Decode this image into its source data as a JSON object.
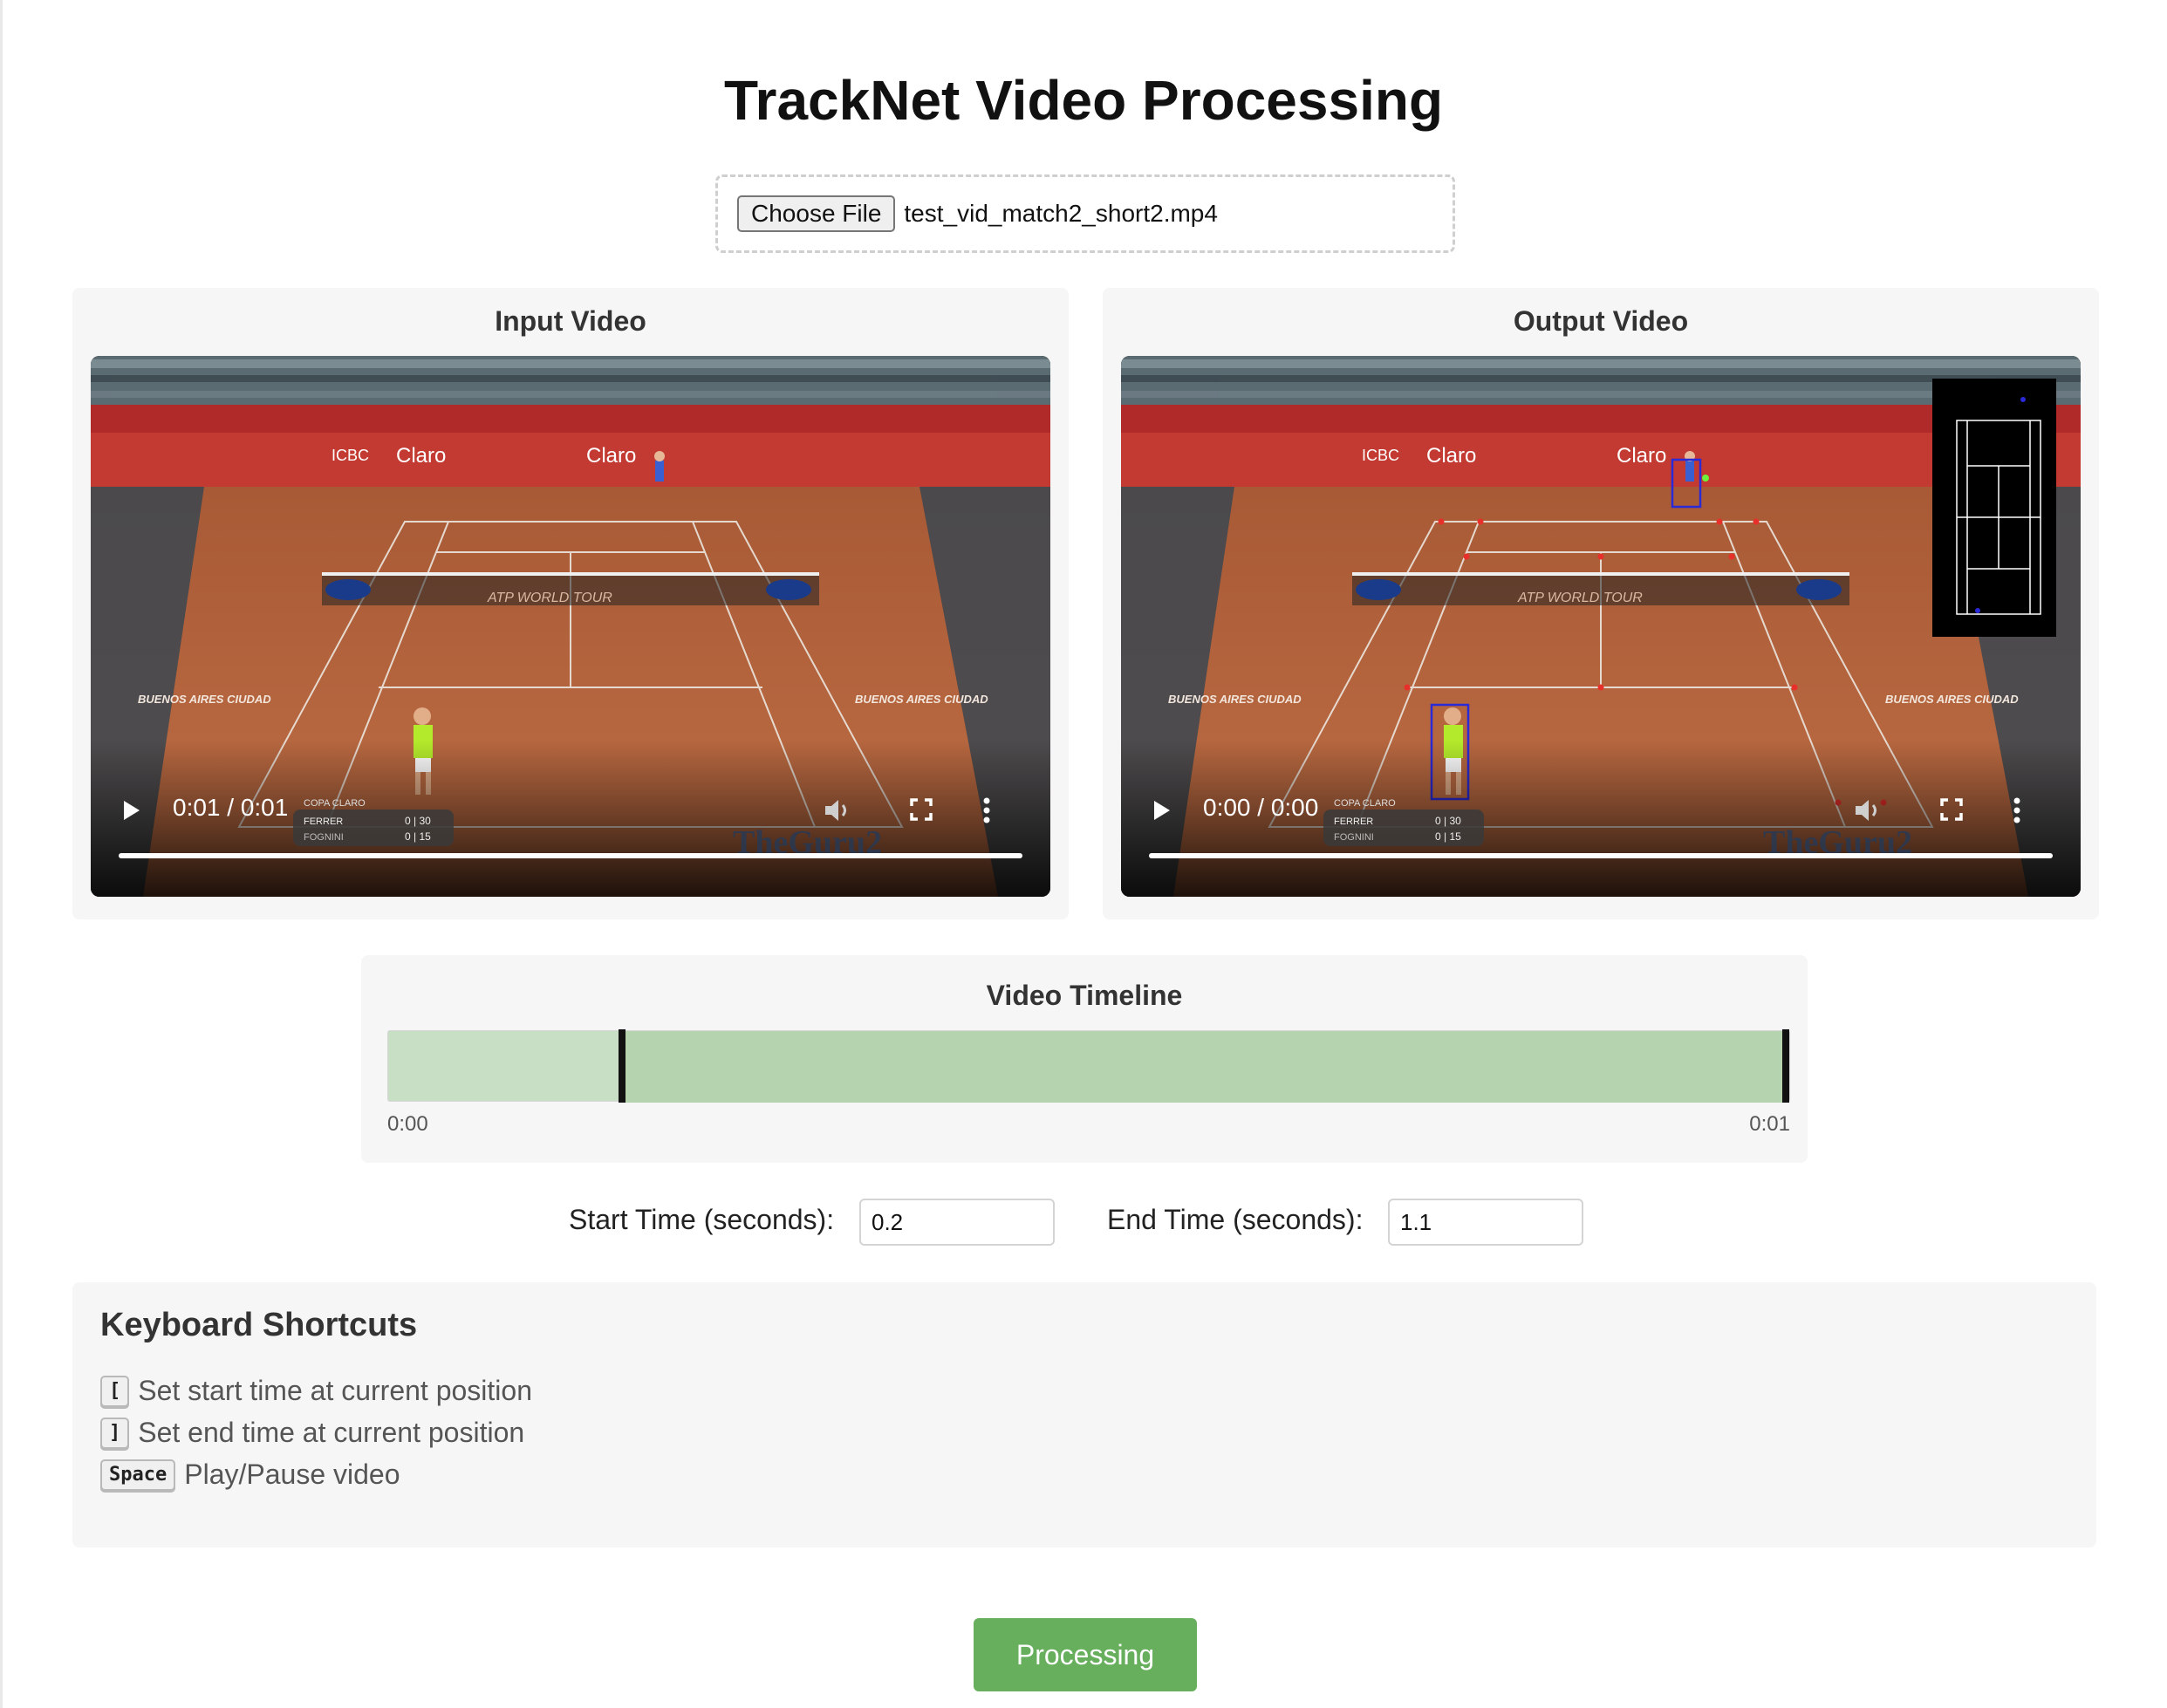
{
  "title": "TrackNet Video Processing",
  "upload": {
    "button_label": "Choose File",
    "file_name": "test_vid_match2_short2.mp4"
  },
  "input_video": {
    "title": "Input Video",
    "time": "0:01 / 0:01",
    "progress": 1.0
  },
  "output_video": {
    "title": "Output Video",
    "time": "0:00 / 0:00",
    "progress": 1.0
  },
  "video_overlay_text": {
    "brand_left": "Claro",
    "brand_right": "Claro",
    "sponsor": "ICBC",
    "court_text": "ATP WORLD TOUR",
    "corner_left": "BUENOS AIRES CIUDAD",
    "corner_right": "BUENOS AIRES CIUDAD",
    "net_logo": "Corona",
    "score_title": "COPA CLARO",
    "player_1": "FERRER",
    "player_2": "FOGNINI",
    "score_1": "0 | 30",
    "score_2": "0 | 15",
    "watermark": "TheGuru2"
  },
  "timeline": {
    "title": "Video Timeline",
    "start_label": "0:00",
    "end_label": "0:01",
    "selection_start_fraction": 0.167,
    "selection_end_fraction": 1.0
  },
  "time_inputs": {
    "start_label": "Start Time (seconds):",
    "start_value": "0.2",
    "end_label": "End Time (seconds):",
    "end_value": "1.1"
  },
  "shortcuts": {
    "title": "Keyboard Shortcuts",
    "items": [
      {
        "key": "[",
        "description": "Set start time at current position"
      },
      {
        "key": "]",
        "description": "Set end time at current position"
      },
      {
        "key": "Space",
        "description": "Play/Pause video"
      }
    ]
  },
  "process_button_label": "Processing",
  "colors": {
    "accent_green": "#67ae5d",
    "timeline_bg": "#c8dec5",
    "timeline_selection": "#b4d3ae",
    "clay": "#b8683f",
    "detection_box": "#2a2ad8",
    "court_keypoint": "#e8302a"
  }
}
